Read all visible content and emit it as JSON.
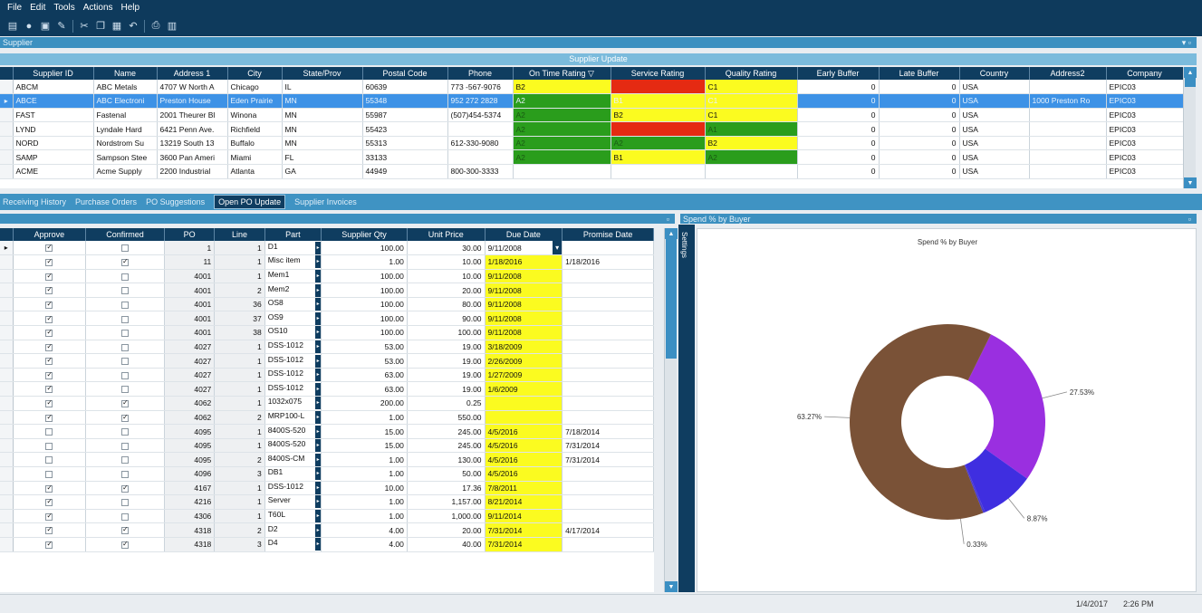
{
  "menu": {
    "items": [
      "File",
      "Edit",
      "Tools",
      "Actions",
      "Help"
    ]
  },
  "toolbar": {
    "icons": [
      "save-icon",
      "new-icon",
      "refresh-icon",
      "clear-icon",
      "cut-icon",
      "copy-icon",
      "paste-icon",
      "undo-icon",
      "print-icon",
      "print-preview-icon"
    ]
  },
  "supplier_panel": {
    "title": "Supplier",
    "band_title": "Supplier Update"
  },
  "supplier_grid": {
    "columns": [
      "Supplier ID",
      "Name",
      "Address 1",
      "City",
      "State/Prov",
      "Postal Code",
      "Phone",
      "On Time Rating",
      "Service Rating",
      "Quality Rating",
      "Early Buffer",
      "Late Buffer",
      "Country",
      "Address2",
      "Company"
    ],
    "rows": [
      {
        "id": "ABCM",
        "name": "ABC Metals",
        "addr": "4707 W North A",
        "city": "Chicago",
        "state": "IL",
        "postal": "60639",
        "phone": "773 -567-9076",
        "ontime": "B2",
        "ontime_color": "y",
        "service": "",
        "service_color": "r",
        "quality": "C1",
        "quality_color": "y",
        "early": "0",
        "late": "0",
        "country": "USA",
        "addr2": "",
        "company": "EPIC03"
      },
      {
        "id": "ABCE",
        "name": "ABC Electroni",
        "addr": "Preston House",
        "city": "Eden Prairie",
        "state": "MN",
        "postal": "55348",
        "phone": "952 272 2828",
        "ontime": "A2",
        "ontime_color": "g",
        "service": "B1",
        "service_color": "y",
        "quality": "C1",
        "quality_color": "y",
        "early": "0",
        "late": "0",
        "country": "USA",
        "addr2": "1000 Preston Ro",
        "company": "EPIC03"
      },
      {
        "id": "FAST",
        "name": "Fastenal",
        "addr": "2001 Theurer Bl",
        "city": "Winona",
        "state": "MN",
        "postal": "55987",
        "phone": "(507)454-5374",
        "ontime": "A2",
        "ontime_color": "g",
        "service": "B2",
        "service_color": "y",
        "quality": "C1",
        "quality_color": "y",
        "early": "0",
        "late": "0",
        "country": "USA",
        "addr2": "",
        "company": "EPIC03"
      },
      {
        "id": "LYND",
        "name": "Lyndale Hard",
        "addr": "6421 Penn Ave.",
        "city": "Richfield",
        "state": "MN",
        "postal": "55423",
        "phone": "",
        "ontime": "A2",
        "ontime_color": "g",
        "service": "",
        "service_color": "r",
        "quality": "A1",
        "quality_color": "g",
        "early": "0",
        "late": "0",
        "country": "USA",
        "addr2": "",
        "company": "EPIC03"
      },
      {
        "id": "NORD",
        "name": "Nordstrom Su",
        "addr": "13219 South 13",
        "city": "Buffalo",
        "state": "MN",
        "postal": "55313",
        "phone": "612-330-9080",
        "ontime": "A2",
        "ontime_color": "g",
        "service": "A2",
        "service_color": "g",
        "quality": "B2",
        "quality_color": "y",
        "early": "0",
        "late": "0",
        "country": "USA",
        "addr2": "",
        "company": "EPIC03"
      },
      {
        "id": "SAMP",
        "name": "Sampson Stee",
        "addr": "3600 Pan Ameri",
        "city": "Miami",
        "state": "FL",
        "postal": "33133",
        "phone": "",
        "ontime": "A2",
        "ontime_color": "g",
        "service": "B1",
        "service_color": "y",
        "quality": "A2",
        "quality_color": "g",
        "early": "0",
        "late": "0",
        "country": "USA",
        "addr2": "",
        "company": "EPIC03"
      },
      {
        "id": "ACME",
        "name": "Acme Supply",
        "addr": "2200 Industrial",
        "city": "Atlanta",
        "state": "GA",
        "postal": "44949",
        "phone": "800-300-3333",
        "ontime": "",
        "ontime_color": "",
        "service": "",
        "service_color": "",
        "quality": "",
        "quality_color": "",
        "early": "0",
        "late": "0",
        "country": "USA",
        "addr2": "",
        "company": "EPIC03"
      }
    ]
  },
  "tabs": [
    "Receiving History",
    "Purchase Orders",
    "PO Suggestions",
    "Open PO Update",
    "Supplier Invoices"
  ],
  "po_grid": {
    "columns": [
      "Approve",
      "Confirmed",
      "PO",
      "Line",
      "Part",
      "Supplier Qty",
      "Unit Price",
      "Due Date",
      "Promise Date"
    ],
    "rows": [
      {
        "approve": true,
        "confirmed": false,
        "po": "1",
        "line": "1",
        "part": "D1",
        "qty": "100.00",
        "price": "30.00",
        "due": "9/11/2008",
        "promise": ""
      },
      {
        "approve": true,
        "confirmed": true,
        "po": "11",
        "line": "1",
        "part": "Misc item",
        "qty": "1.00",
        "price": "10.00",
        "due": "1/18/2016",
        "promise": "1/18/2016"
      },
      {
        "approve": true,
        "confirmed": false,
        "po": "4001",
        "line": "1",
        "part": "Mem1",
        "qty": "100.00",
        "price": "10.00",
        "due": "9/11/2008",
        "promise": ""
      },
      {
        "approve": true,
        "confirmed": false,
        "po": "4001",
        "line": "2",
        "part": "Mem2",
        "qty": "100.00",
        "price": "20.00",
        "due": "9/11/2008",
        "promise": ""
      },
      {
        "approve": true,
        "confirmed": false,
        "po": "4001",
        "line": "36",
        "part": "OS8",
        "qty": "100.00",
        "price": "80.00",
        "due": "9/11/2008",
        "promise": ""
      },
      {
        "approve": true,
        "confirmed": false,
        "po": "4001",
        "line": "37",
        "part": "OS9",
        "qty": "100.00",
        "price": "90.00",
        "due": "9/11/2008",
        "promise": ""
      },
      {
        "approve": true,
        "confirmed": false,
        "po": "4001",
        "line": "38",
        "part": "OS10",
        "qty": "100.00",
        "price": "100.00",
        "due": "9/11/2008",
        "promise": ""
      },
      {
        "approve": true,
        "confirmed": false,
        "po": "4027",
        "line": "1",
        "part": "DSS-1012",
        "qty": "53.00",
        "price": "19.00",
        "due": "3/18/2009",
        "promise": ""
      },
      {
        "approve": true,
        "confirmed": false,
        "po": "4027",
        "line": "1",
        "part": "DSS-1012",
        "qty": "53.00",
        "price": "19.00",
        "due": "2/26/2009",
        "promise": ""
      },
      {
        "approve": true,
        "confirmed": false,
        "po": "4027",
        "line": "1",
        "part": "DSS-1012",
        "qty": "63.00",
        "price": "19.00",
        "due": "1/27/2009",
        "promise": ""
      },
      {
        "approve": true,
        "confirmed": false,
        "po": "4027",
        "line": "1",
        "part": "DSS-1012",
        "qty": "63.00",
        "price": "19.00",
        "due": "1/6/2009",
        "promise": ""
      },
      {
        "approve": true,
        "confirmed": true,
        "po": "4062",
        "line": "1",
        "part": "1032x075",
        "qty": "200.00",
        "price": "0.25",
        "due": "",
        "promise": ""
      },
      {
        "approve": true,
        "confirmed": true,
        "po": "4062",
        "line": "2",
        "part": "MRP100-L",
        "qty": "1.00",
        "price": "550.00",
        "due": "",
        "promise": ""
      },
      {
        "approve": false,
        "confirmed": false,
        "po": "4095",
        "line": "1",
        "part": "8400S-520",
        "qty": "15.00",
        "price": "245.00",
        "due": "4/5/2016",
        "promise": "7/18/2014"
      },
      {
        "approve": false,
        "confirmed": false,
        "po": "4095",
        "line": "1",
        "part": "8400S-520",
        "qty": "15.00",
        "price": "245.00",
        "due": "4/5/2016",
        "promise": "7/31/2014"
      },
      {
        "approve": false,
        "confirmed": false,
        "po": "4095",
        "line": "2",
        "part": "8400S-CM",
        "qty": "1.00",
        "price": "130.00",
        "due": "4/5/2016",
        "promise": "7/31/2014"
      },
      {
        "approve": false,
        "confirmed": false,
        "po": "4096",
        "line": "3",
        "part": "DB1",
        "qty": "1.00",
        "price": "50.00",
        "due": "4/5/2016",
        "promise": ""
      },
      {
        "approve": true,
        "confirmed": true,
        "po": "4167",
        "line": "1",
        "part": "DSS-1012",
        "qty": "10.00",
        "price": "17.36",
        "due": "7/8/2011",
        "promise": ""
      },
      {
        "approve": true,
        "confirmed": false,
        "po": "4216",
        "line": "1",
        "part": "Server",
        "qty": "1.00",
        "price": "1,157.00",
        "due": "8/21/2014",
        "promise": ""
      },
      {
        "approve": true,
        "confirmed": false,
        "po": "4306",
        "line": "1",
        "part": "T60L",
        "qty": "1.00",
        "price": "1,000.00",
        "due": "9/11/2014",
        "promise": ""
      },
      {
        "approve": true,
        "confirmed": true,
        "po": "4318",
        "line": "2",
        "part": "D2",
        "qty": "4.00",
        "price": "20.00",
        "due": "7/31/2014",
        "promise": "4/17/2014"
      },
      {
        "approve": true,
        "confirmed": true,
        "po": "4318",
        "line": "3",
        "part": "D4",
        "qty": "4.00",
        "price": "40.00",
        "due": "7/31/2014",
        "promise": ""
      }
    ]
  },
  "spend_panel": {
    "title": "Spend % by Buyer",
    "settings_label": "Settings"
  },
  "chart_data": {
    "type": "pie",
    "title": "Spend % by Buyer",
    "slices": [
      {
        "label": "27.53%",
        "value": 27.53,
        "color": "#9a2fe0"
      },
      {
        "label": "8.87%",
        "value": 8.87,
        "color": "#3f2ee0"
      },
      {
        "label": "0.33%",
        "value": 0.33,
        "color": "#4a3ad0"
      },
      {
        "label": "63.27%",
        "value": 63.27,
        "color": "#7a5237"
      }
    ],
    "donut": true
  },
  "statusbar": {
    "date": "1/4/2017",
    "time": "2:26 PM"
  }
}
